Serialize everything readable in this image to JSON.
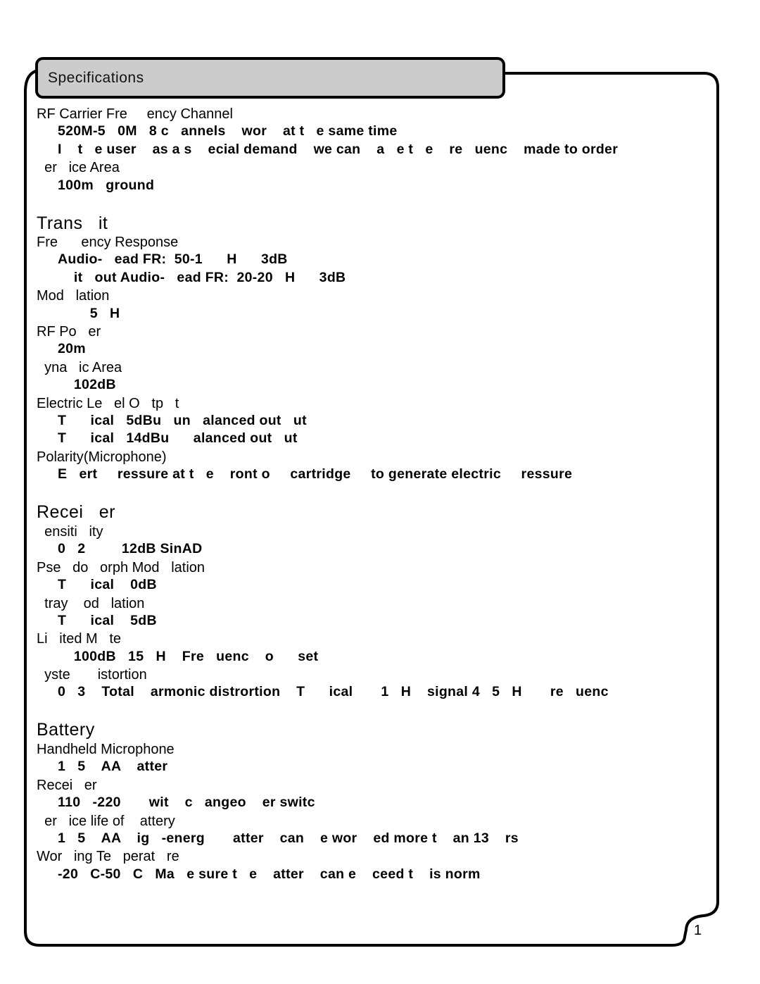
{
  "tab": {
    "title": "Specifications"
  },
  "lines": [
    {
      "kind": "label",
      "text": "RF Carrier Fre     ency Channel"
    },
    {
      "kind": "value",
      "text": "520M-5   0M   8 c   annels    wor    at t   e same time"
    },
    {
      "kind": "value",
      "text": "I    t   e user    as a s    ecial demand    we can    a   e t   e    re   uenc    made to order"
    },
    {
      "kind": "label",
      "text": "  er   ice Area"
    },
    {
      "kind": "value",
      "text": "100m   ground"
    },
    {
      "kind": "heading",
      "text": "Trans   it"
    },
    {
      "kind": "label",
      "text": "Fre      ency Response"
    },
    {
      "kind": "value",
      "text": "Audio-   ead FR:  50-1      H      3dB"
    },
    {
      "kind": "value",
      "text": "    it   out Audio-   ead FR:  20-20   H      3dB"
    },
    {
      "kind": "label",
      "text": "Mod   lation"
    },
    {
      "kind": "value",
      "text": "        5   H"
    },
    {
      "kind": "label",
      "text": "RF Po   er"
    },
    {
      "kind": "value",
      "text": "20m"
    },
    {
      "kind": "label",
      "text": "  yna   ic Area"
    },
    {
      "kind": "value",
      "text": "    102dB"
    },
    {
      "kind": "label",
      "text": "Electric Le   el O   tp   t"
    },
    {
      "kind": "value",
      "text": "T      ical   5dBu   un   alanced out   ut"
    },
    {
      "kind": "value",
      "text": "T      ical   14dBu      alanced out   ut"
    },
    {
      "kind": "label",
      "text": "Polarity(Microphone)"
    },
    {
      "kind": "value",
      "text": "E   ert     ressure at t   e    ront o     cartridge     to generate electric     ressure"
    },
    {
      "kind": "heading",
      "text": "Recei   er"
    },
    {
      "kind": "label",
      "text": "  ensiti   ity"
    },
    {
      "kind": "value",
      "text": "0   2         12dB SinAD"
    },
    {
      "kind": "label",
      "text": "Pse   do   orph Mod   lation"
    },
    {
      "kind": "value",
      "text": "T      ical    0dB"
    },
    {
      "kind": "label",
      "text": "  tray    od   lation"
    },
    {
      "kind": "value",
      "text": "T      ical    5dB"
    },
    {
      "kind": "label",
      "text": "Li   ited M   te"
    },
    {
      "kind": "value",
      "text": "    100dB   15   H    Fre   uenc    o      set"
    },
    {
      "kind": "label",
      "text": "  yste       istortion"
    },
    {
      "kind": "value",
      "text": "0   3    Total    armonic distrortion    T      ical       1   H    signal 4   5   H       re   uenc"
    },
    {
      "kind": "heading",
      "text": "Battery"
    },
    {
      "kind": "label",
      "text": "Handheld Microphone"
    },
    {
      "kind": "value",
      "text": "1   5    AA    atter"
    },
    {
      "kind": "label",
      "text": "Recei   er"
    },
    {
      "kind": "value",
      "text": "110   -220       wit    c   angeo    er switc"
    },
    {
      "kind": "label",
      "text": "  er   ice life of    attery"
    },
    {
      "kind": "value",
      "text": "1   5    AA    ig   -energ       atter    can    e wor    ed more t    an 13    rs"
    },
    {
      "kind": "label",
      "text": "Wor   ing Te   perat   re"
    },
    {
      "kind": "value",
      "text": "-20   C-50   C   Ma   e sure t   e    atter    can e    ceed t    is norm"
    }
  ],
  "page_number": "1",
  "colors": {
    "tab_fill": "#cccccc",
    "border": "#000000"
  }
}
